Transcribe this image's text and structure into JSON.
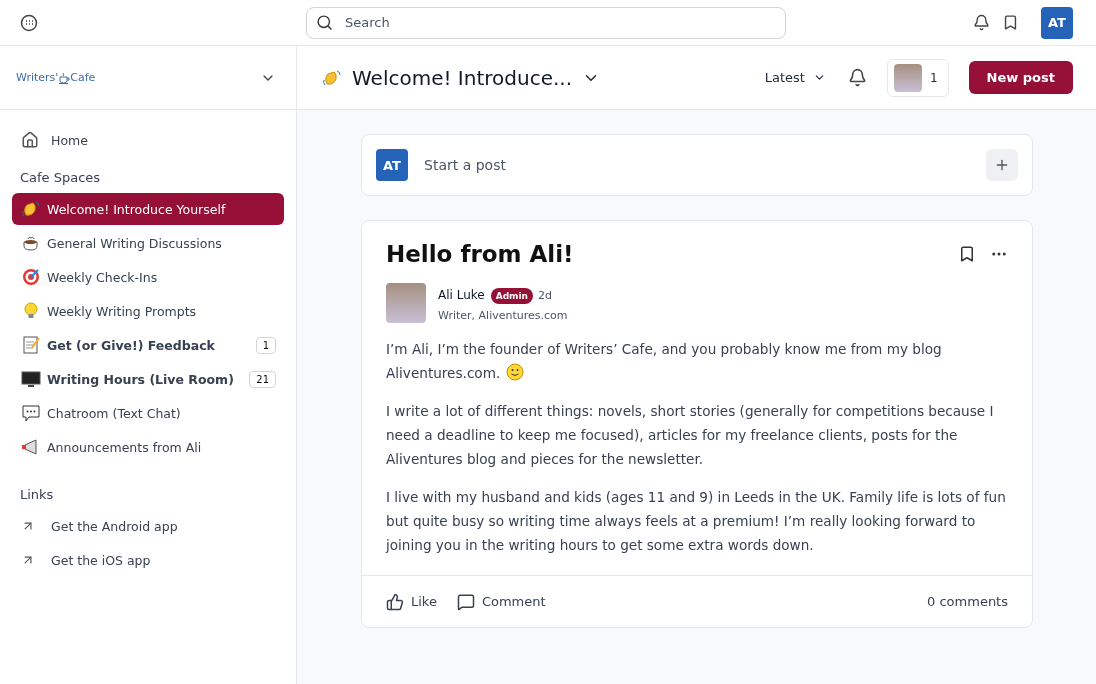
{
  "topbar": {
    "search_placeholder": "Search",
    "avatar": "AT"
  },
  "sidebar": {
    "logo": [
      "Writers'",
      "Cafe"
    ],
    "home": "Home",
    "spaces_heading": "Cafe Spaces",
    "spaces": [
      {
        "label": "Welcome! Introduce Yourself",
        "selected": true,
        "unread": false
      },
      {
        "label": "General Writing Discussions",
        "selected": false,
        "unread": false
      },
      {
        "label": "Weekly Check-Ins",
        "selected": false,
        "unread": false
      },
      {
        "label": "Weekly Writing Prompts",
        "selected": false,
        "unread": false
      },
      {
        "label": "Get (or Give!) Feedback",
        "selected": false,
        "unread": true,
        "count": "1"
      },
      {
        "label": "Writing Hours (Live Room)",
        "selected": false,
        "unread": true,
        "count": "21"
      },
      {
        "label": "Chatroom (Text Chat)",
        "selected": false,
        "unread": false
      },
      {
        "label": "Announcements from Ali",
        "selected": false,
        "unread": false
      }
    ],
    "links_heading": "Links",
    "links": [
      "Get the Android app",
      "Get the iOS app"
    ]
  },
  "header": {
    "title": "Welcome! Introduce...",
    "sort": "Latest",
    "members": "1",
    "new_post": "New post"
  },
  "composer": {
    "avatar": "AT",
    "placeholder": "Start a post"
  },
  "post": {
    "title": "Hello from Ali!",
    "author": "Ali Luke",
    "badge": "Admin",
    "time": "2d",
    "bio": "Writer, Aliventures.com",
    "paragraphs": [
      "I’m Ali, I’m the founder of Writers’ Cafe, and you probably know me from my blog Aliventures.com.",
      "I write a lot of different things: novels, short stories (generally for competitions because I need a deadline to keep me focused), articles for my freelance clients, posts for the Aliventures blog and pieces for the newsletter.",
      "I live with my husband and kids (ages 11 and 9) in Leeds in the UK. Family life is lots of fun but quite busy so writing time always feels at a premium! I’m really looking forward to joining you in the writing hours to get some extra words down."
    ],
    "like": "Like",
    "comment": "Comment",
    "comments_count": "0 comments"
  }
}
